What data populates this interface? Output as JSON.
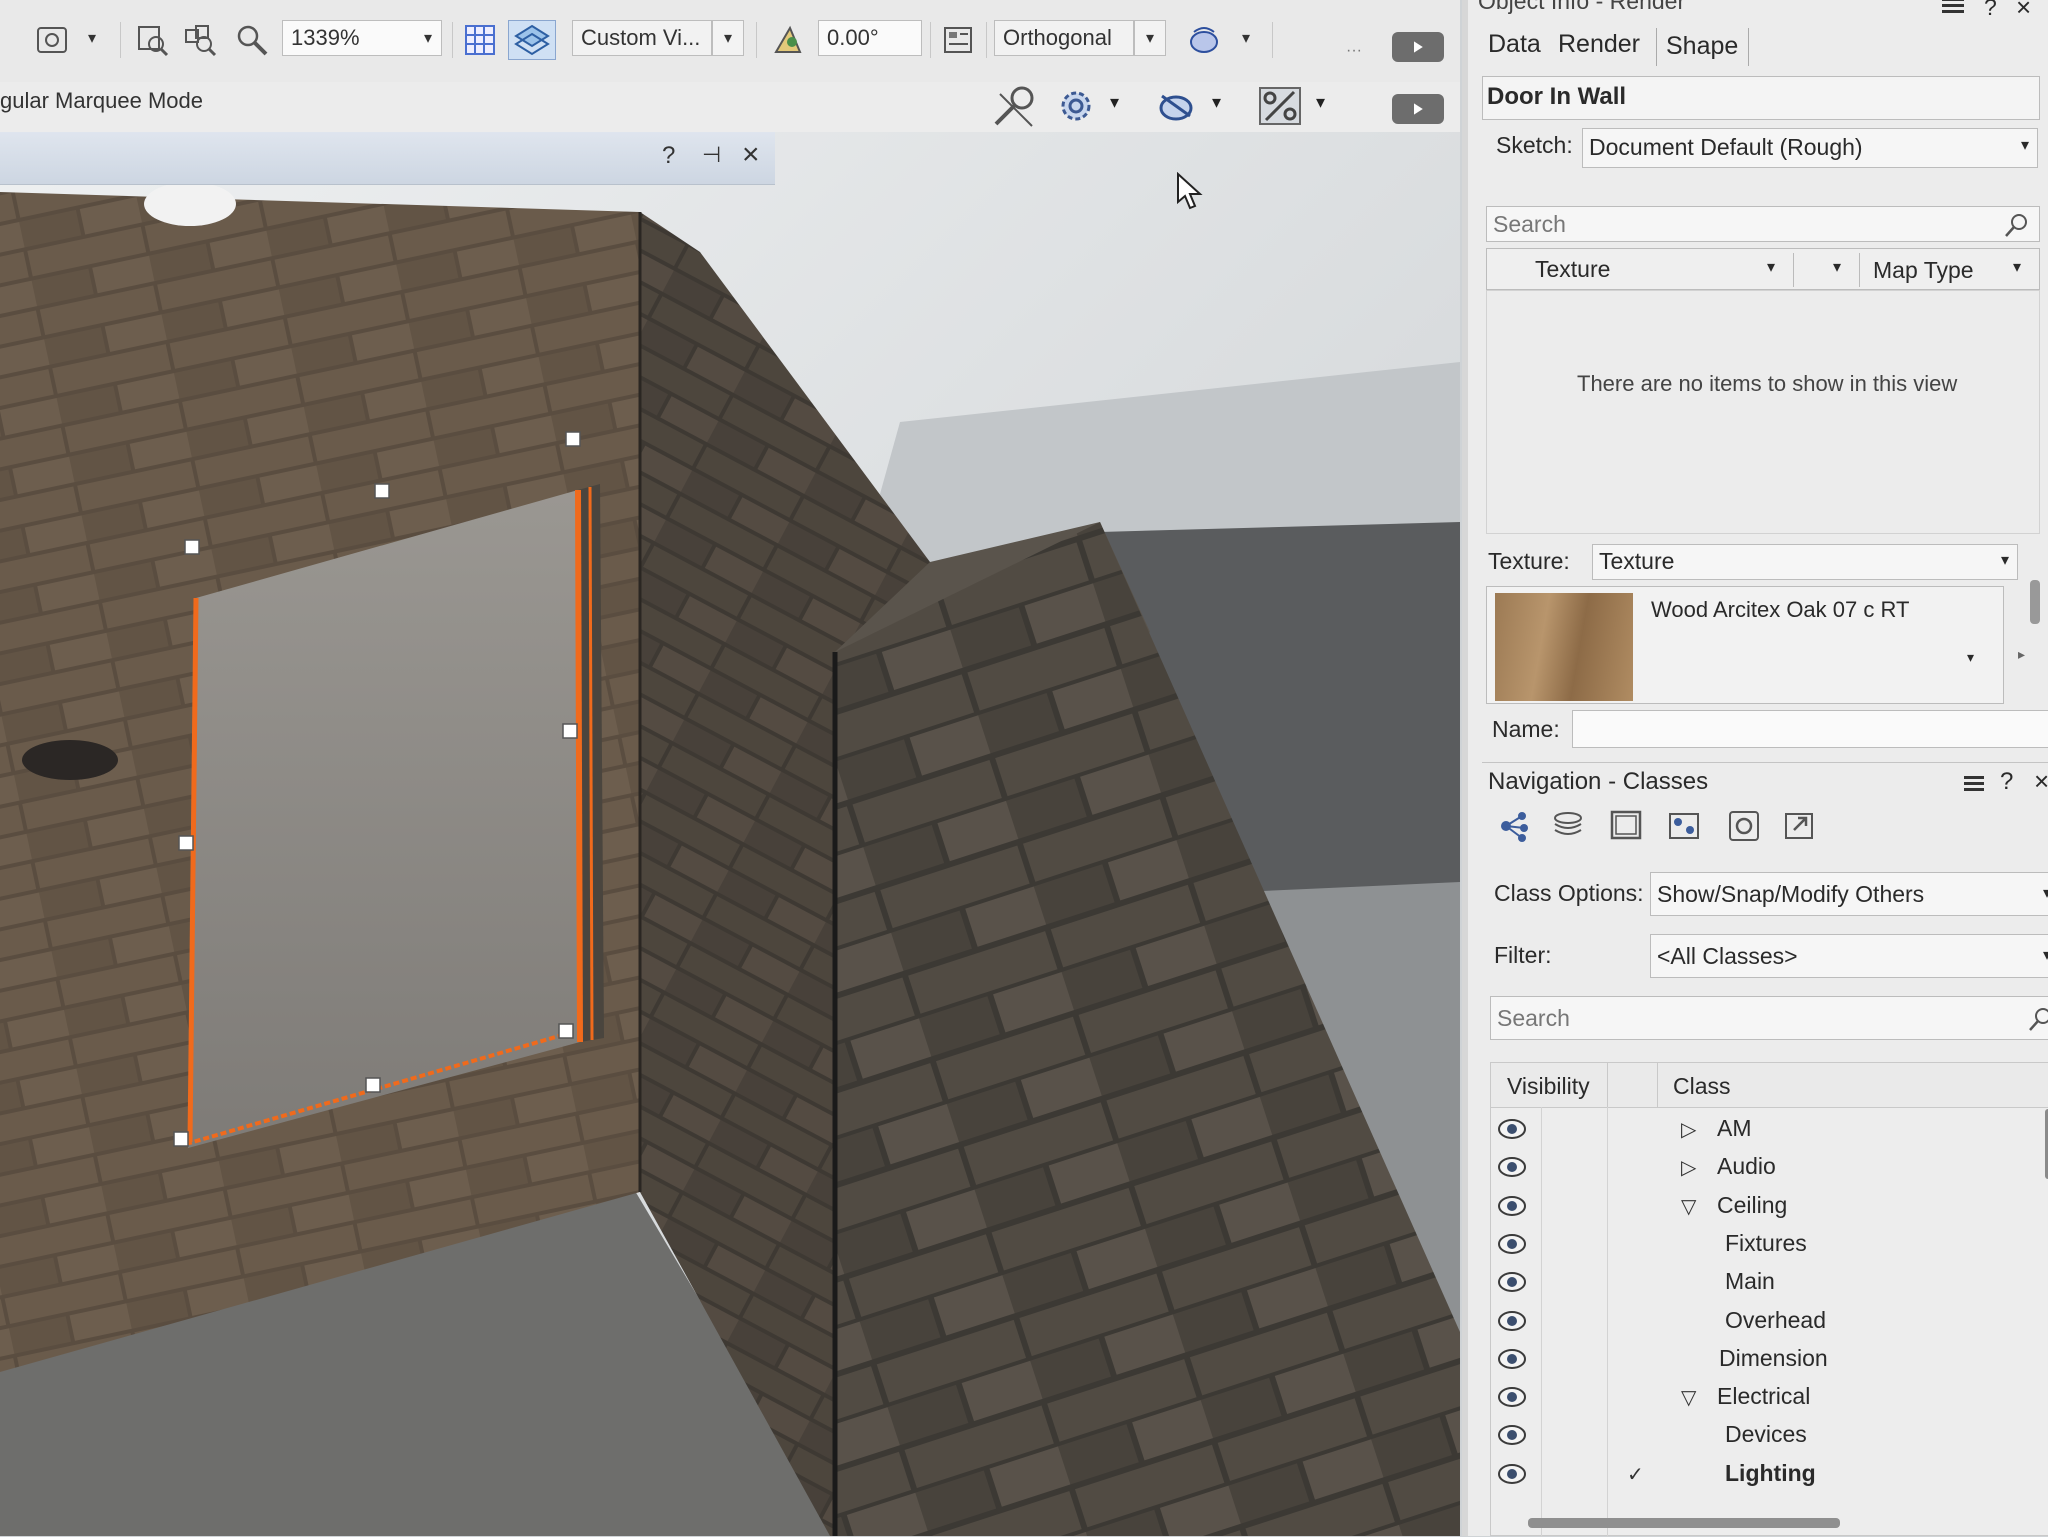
{
  "toolbar": {
    "zoom_value": "1339%",
    "view_label": "Custom Vi...",
    "angle_value": "0.00°",
    "projection_label": "Orthogonal"
  },
  "mode_bar": {
    "mode_label": "gular Marquee Mode"
  },
  "floating_palette": {
    "help_label": "?",
    "pin_label": "⊣",
    "close_label": "×"
  },
  "object_info": {
    "title": "Object Info - Render",
    "tabs": [
      "Data",
      "Render",
      "Shape"
    ],
    "object_type": "Door In Wall",
    "sketch_label": "Sketch:",
    "sketch_value": "Document Default (Rough)",
    "search_placeholder": "Search",
    "col_texture": "Texture",
    "col_map_type": "Map Type",
    "empty_message": "There are no items to show in this view",
    "texture_label": "Texture:",
    "texture_value": "Texture",
    "texture_name": "Wood Arcitex Oak 07 c RT",
    "name_label": "Name:",
    "name_value": ""
  },
  "navigation": {
    "title": "Navigation - Classes",
    "class_options_label": "Class Options:",
    "class_options_value": "Show/Snap/Modify Others",
    "filter_label": "Filter:",
    "filter_value": "<All Classes>",
    "search_placeholder": "Search",
    "col_visibility": "Visibility",
    "col_class": "Class",
    "classes": [
      {
        "name": "AM",
        "level": 0,
        "expander": "▷",
        "checked": false,
        "bold": false
      },
      {
        "name": "Audio",
        "level": 0,
        "expander": "▷",
        "checked": false,
        "bold": false
      },
      {
        "name": "Ceiling",
        "level": 0,
        "expander": "▽",
        "checked": false,
        "bold": false
      },
      {
        "name": "Fixtures",
        "level": 1,
        "expander": "",
        "checked": false,
        "bold": false
      },
      {
        "name": "Main",
        "level": 1,
        "expander": "",
        "checked": false,
        "bold": false
      },
      {
        "name": "Overhead",
        "level": 1,
        "expander": "",
        "checked": false,
        "bold": false
      },
      {
        "name": "Dimension",
        "level": 0,
        "expander": "",
        "checked": false,
        "bold": false
      },
      {
        "name": "Electrical",
        "level": 0,
        "expander": "▽",
        "checked": false,
        "bold": false
      },
      {
        "name": "Devices",
        "level": 1,
        "expander": "",
        "checked": false,
        "bold": false
      },
      {
        "name": "Lighting",
        "level": 1,
        "expander": "",
        "checked": true,
        "bold": true
      }
    ]
  },
  "colors": {
    "selection_orange": "#f06a1c",
    "panel_bg": "#ececec",
    "sky": "#dde1e3",
    "stone_dark": "#4a4036"
  },
  "icons": [
    "render-mode-icon",
    "zoom-fit-icon",
    "zoom-objects-icon",
    "magnifier-icon",
    "grid-icon",
    "working-plane-icon",
    "angle-snap-icon",
    "page-layout-icon",
    "flyover-icon",
    "play-icon",
    "walkthrough-icon",
    "settings-gear-icon",
    "rotate-view-icon",
    "percent-snap-icon",
    "hamburger-menu-icon",
    "help-icon",
    "close-icon",
    "eye-icon",
    "checkmark-icon"
  ]
}
